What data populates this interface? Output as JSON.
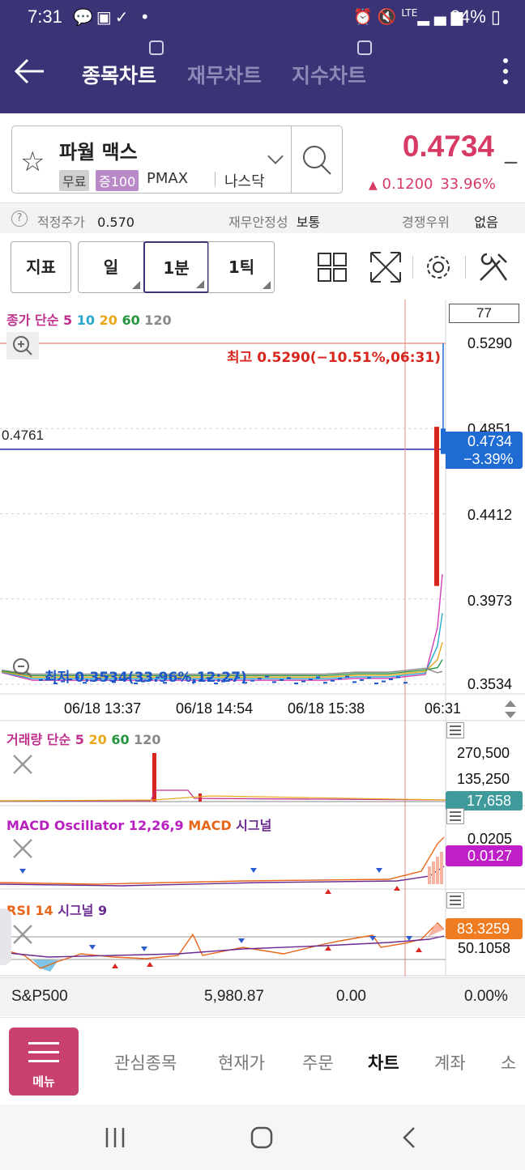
{
  "status_bar": {
    "time": "7:31",
    "battery": "24%",
    "network": "LTE"
  },
  "header": {
    "tabs": [
      {
        "label": "종목차트",
        "active": true
      },
      {
        "label": "재무차트",
        "active": false
      },
      {
        "label": "지수차트",
        "active": false
      }
    ]
  },
  "stock": {
    "name": "파월 맥스",
    "tag_free": "무료",
    "tag_margin": "증100",
    "ticker": "PMAX",
    "market": "나스닥",
    "price": "0.4734",
    "price_suffix": "_",
    "change": "0.1200",
    "change_pct": "33.96%",
    "change_direction": "up",
    "color_up": "#d83a66"
  },
  "info_row": {
    "fair_price_label": "적정주가",
    "fair_price": "0.570",
    "stability_label": "재무안정성",
    "stability": "보통",
    "competitive_label": "경쟁우위",
    "competitive": "없음"
  },
  "toolbar": {
    "indicator": "지표",
    "periods": [
      {
        "label": "일",
        "selected": false
      },
      {
        "label": "1분",
        "selected": true
      },
      {
        "label": "1틱",
        "selected": false
      }
    ],
    "icons": [
      "layout-grid-icon",
      "fullscreen-icon",
      "settings-gear-icon",
      "tools-icon"
    ]
  },
  "chart": {
    "price_pane": {
      "legend_label": "종가 단순",
      "ma_periods": [
        "5",
        "10",
        "20",
        "60",
        "120"
      ],
      "ma_colors": [
        "#d43cb4",
        "#2aa9cf",
        "#e9a81c",
        "#26963e",
        "#888888"
      ],
      "bar_count": "77",
      "y_ticks": [
        "0.5290",
        "0.4851",
        "0.4412",
        "0.3973",
        "0.3534"
      ],
      "crosshair_value": "0.4761",
      "high_label": "최고 0.5290(−10.51%,06:31)",
      "low_label": "최저 0.3534(33.96%,12:27)",
      "current_price_tag": "0.4734",
      "current_pct_tag": "−3.39%",
      "x_ticks": [
        "06/18 13:37",
        "06/18 14:54",
        "06/18 15:38",
        "06:31"
      ]
    },
    "volume_pane": {
      "title": "거래량 단순",
      "ma_periods": [
        "5",
        "20",
        "60",
        "120"
      ],
      "y_ticks": [
        "270,500",
        "135,250"
      ],
      "current_tag": "17,658"
    },
    "macd_pane": {
      "title_osc": "MACD Oscillator 12,26,9",
      "title_macd": "MACD",
      "title_signal": "시그널",
      "y_ticks": [
        "0.0205"
      ],
      "current_tag": "0.0127"
    },
    "rsi_pane": {
      "title_rsi": "RSI 14",
      "title_signal": "시그널 9",
      "y_ticks": [
        "50.1058"
      ],
      "current_tag": "83.3259"
    }
  },
  "index_bar": {
    "name": "S&P500",
    "value": "5,980.87",
    "change": "0.00",
    "change_pct": "0.00%"
  },
  "bottom_nav": {
    "menu_label": "메뉴",
    "items": [
      {
        "label": "관심종목",
        "active": false
      },
      {
        "label": "현재가",
        "active": false
      },
      {
        "label": "주문",
        "active": false
      },
      {
        "label": "차트",
        "active": true
      },
      {
        "label": "계좌",
        "active": false
      },
      {
        "label": "소",
        "active": false
      }
    ]
  }
}
